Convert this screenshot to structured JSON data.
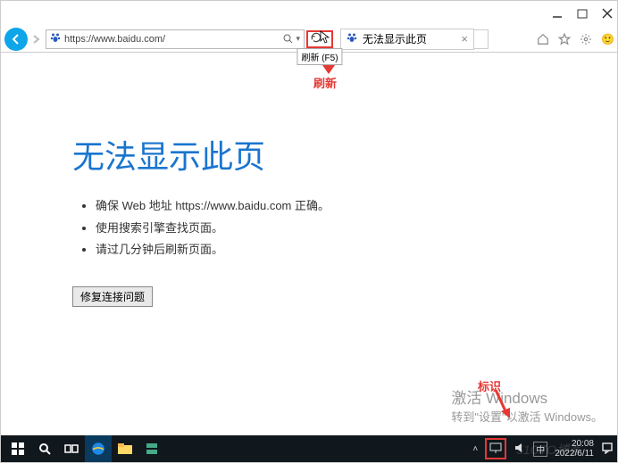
{
  "titlebar": {},
  "toolbar": {
    "url": "https://www.baidu.com/",
    "tooltip": "刷新 (F5)",
    "tab_title": "无法显示此页"
  },
  "annotations": {
    "refresh": "刷新",
    "identifier": "标识"
  },
  "page": {
    "title": "无法显示此页",
    "items": [
      "确保 Web 地址 https://www.baidu.com 正确。",
      "使用搜索引擎查找页面。",
      "请过几分钟后刷新页面。"
    ],
    "fix_button": "修复连接问题"
  },
  "activate": {
    "line1": "激活 Windows",
    "line2": "转到\"设置\"以激活 Windows。"
  },
  "taskbar": {
    "ime": "中",
    "time": "20:08",
    "date": "2022/6/11"
  },
  "watermark": "51CTO博客"
}
